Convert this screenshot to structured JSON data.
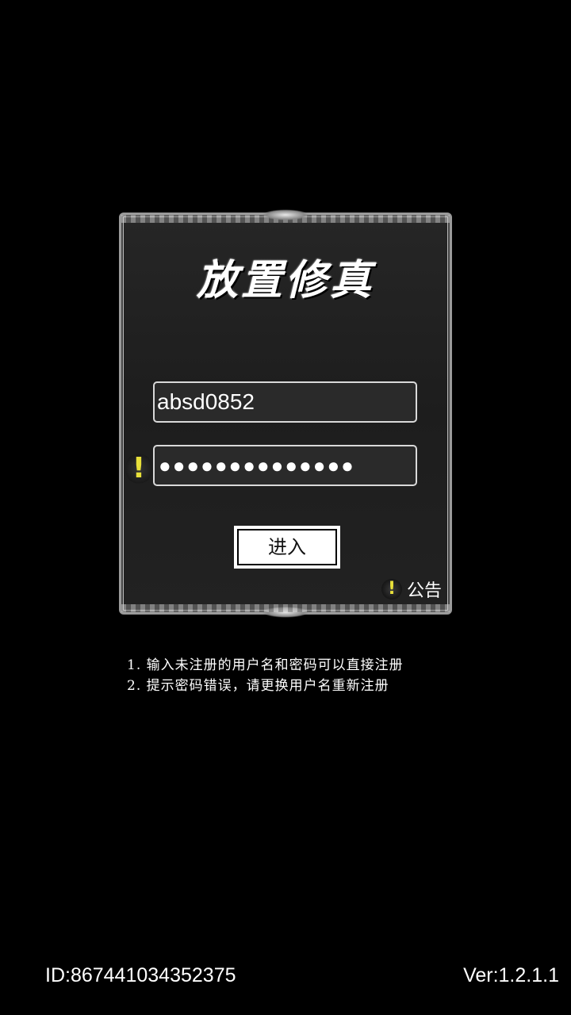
{
  "login_panel": {
    "game_title": "放置修真",
    "username_value": "absd0852",
    "password_masked": "●●●●●●●●●●●●●●",
    "password_warning_icon": "!",
    "enter_button_label": "进入",
    "notice": {
      "icon": "!",
      "label": "公告"
    }
  },
  "tips": [
    "1. 输入未注册的用户名和密码可以直接注册",
    "2. 提示密码错误，请更换用户名重新注册"
  ],
  "footer": {
    "device_id": "ID:867441034352375",
    "version": "Ver:1.2.1.1"
  },
  "colors": {
    "background": "#000000",
    "panel": "#222222",
    "frame": "#bdbdbd",
    "warning": "#e8e03a",
    "text": "#ffffff"
  },
  "icons": {
    "password_warning": "warning-exclamation-icon",
    "notice": "warning-exclamation-icon"
  }
}
